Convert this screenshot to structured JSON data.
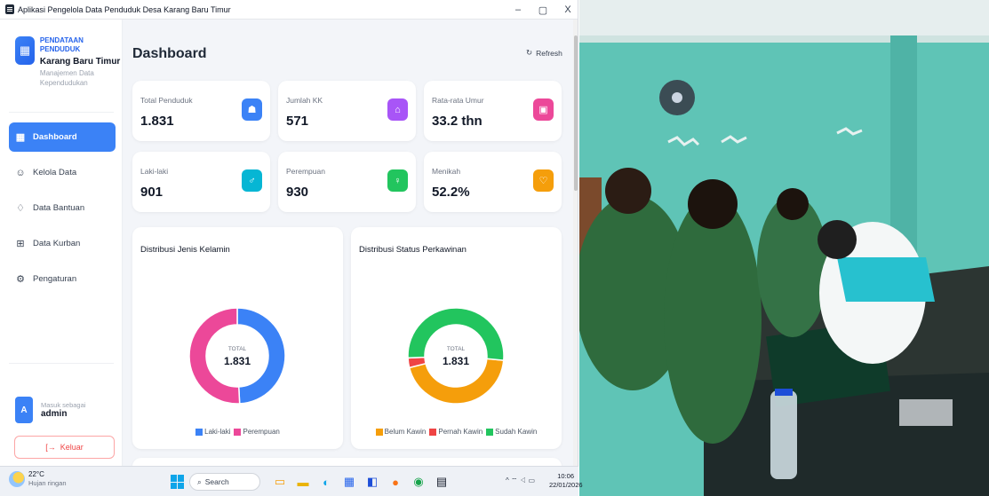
{
  "window": {
    "title": "Aplikasi Pengelola Data Penduduk Desa Karang Baru Timur",
    "minimize": "–",
    "maximize": "▢",
    "close": "X"
  },
  "sidebar": {
    "brand_title": "PENDATAAN PENDUDUK",
    "brand_name": "Karang Baru Timur",
    "brand_desc": "Manajemen Data Kependudukan",
    "items": [
      {
        "label": "Dashboard",
        "icon": "grid-icon",
        "glyph": "▦",
        "active": true
      },
      {
        "label": "Kelola Data",
        "icon": "users-icon",
        "glyph": "☺",
        "active": false
      },
      {
        "label": "Data Bantuan",
        "icon": "heart-hand-icon",
        "glyph": "♢",
        "active": false
      },
      {
        "label": "Data Kurban",
        "icon": "gift-icon",
        "glyph": "⊞",
        "active": false
      },
      {
        "label": "Pengaturan",
        "icon": "gear-icon",
        "glyph": "⚙",
        "active": false
      }
    ],
    "user_label": "Masuk sebagai",
    "user_name": "admin",
    "user_initial": "A",
    "logout_label": "Keluar",
    "logout_glyph": "[→"
  },
  "header": {
    "title": "Dashboard",
    "refresh_label": "Refresh",
    "refresh_glyph": "↻"
  },
  "stats": [
    {
      "label": "Total Penduduk",
      "value": "1.831",
      "icon": "people-icon",
      "glyph": "☗",
      "color": "#3b82f6"
    },
    {
      "label": "Jumlah KK",
      "value": "571",
      "icon": "home-icon",
      "glyph": "⌂",
      "color": "#a855f7"
    },
    {
      "label": "Rata-rata Umur",
      "value": "33.2 thn",
      "icon": "calendar-icon",
      "glyph": "▣",
      "color": "#ec4899"
    },
    {
      "label": "Laki-laki",
      "value": "901",
      "icon": "male-user-icon",
      "glyph": "♂",
      "color": "#06b6d4"
    },
    {
      "label": "Perempuan",
      "value": "930",
      "icon": "female-user-icon",
      "glyph": "♀",
      "color": "#22c55e"
    },
    {
      "label": "Menikah",
      "value": "52.2%",
      "icon": "heart-icon",
      "glyph": "♡",
      "color": "#f59e0b"
    }
  ],
  "chart_data": [
    {
      "type": "pie",
      "title": "Distribusi Jenis Kelamin",
      "center_label": "TOTAL",
      "center_value": "1.831",
      "categories": [
        "Laki-laki",
        "Perempuan"
      ],
      "values": [
        901,
        930
      ],
      "colors": [
        "#3b82f6",
        "#ec4899"
      ],
      "legend": "bottom"
    },
    {
      "type": "pie",
      "title": "Distribusi Status Perkawinan",
      "center_label": "TOTAL",
      "center_value": "1.831",
      "categories": [
        "Belum Kawin",
        "Pernah Kawin",
        "Sudah Kawin"
      ],
      "values": [
        815,
        60,
        956
      ],
      "colors": [
        "#f59e0b",
        "#ef4444",
        "#22c55e"
      ],
      "legend": "bottom"
    }
  ],
  "taskbar": {
    "temp": "22°C",
    "weather": "Hujan ringan",
    "search_label": "Search",
    "search_glyph": "⌕",
    "apps": [
      {
        "name": "taskbar-widget-icon",
        "glyph": "▭",
        "color": "#f59e0b"
      },
      {
        "name": "taskbar-file-explorer-icon",
        "glyph": "▬",
        "color": "#eab308"
      },
      {
        "name": "taskbar-edge-icon",
        "glyph": "◐",
        "color": "#0ea5e9"
      },
      {
        "name": "taskbar-store-icon",
        "glyph": "▦",
        "color": "#2563eb"
      },
      {
        "name": "taskbar-app-icon",
        "glyph": "◧",
        "color": "#1d4ed8"
      },
      {
        "name": "taskbar-firefox-icon",
        "glyph": "●",
        "color": "#f97316"
      },
      {
        "name": "taskbar-chrome-icon",
        "glyph": "◉",
        "color": "#16a34a"
      },
      {
        "name": "taskbar-running-app-icon",
        "glyph": "▤",
        "color": "#111827"
      }
    ],
    "tray": "^ ⌔ ◁ ▭",
    "time": "10:06",
    "date": "22/01/2026"
  }
}
